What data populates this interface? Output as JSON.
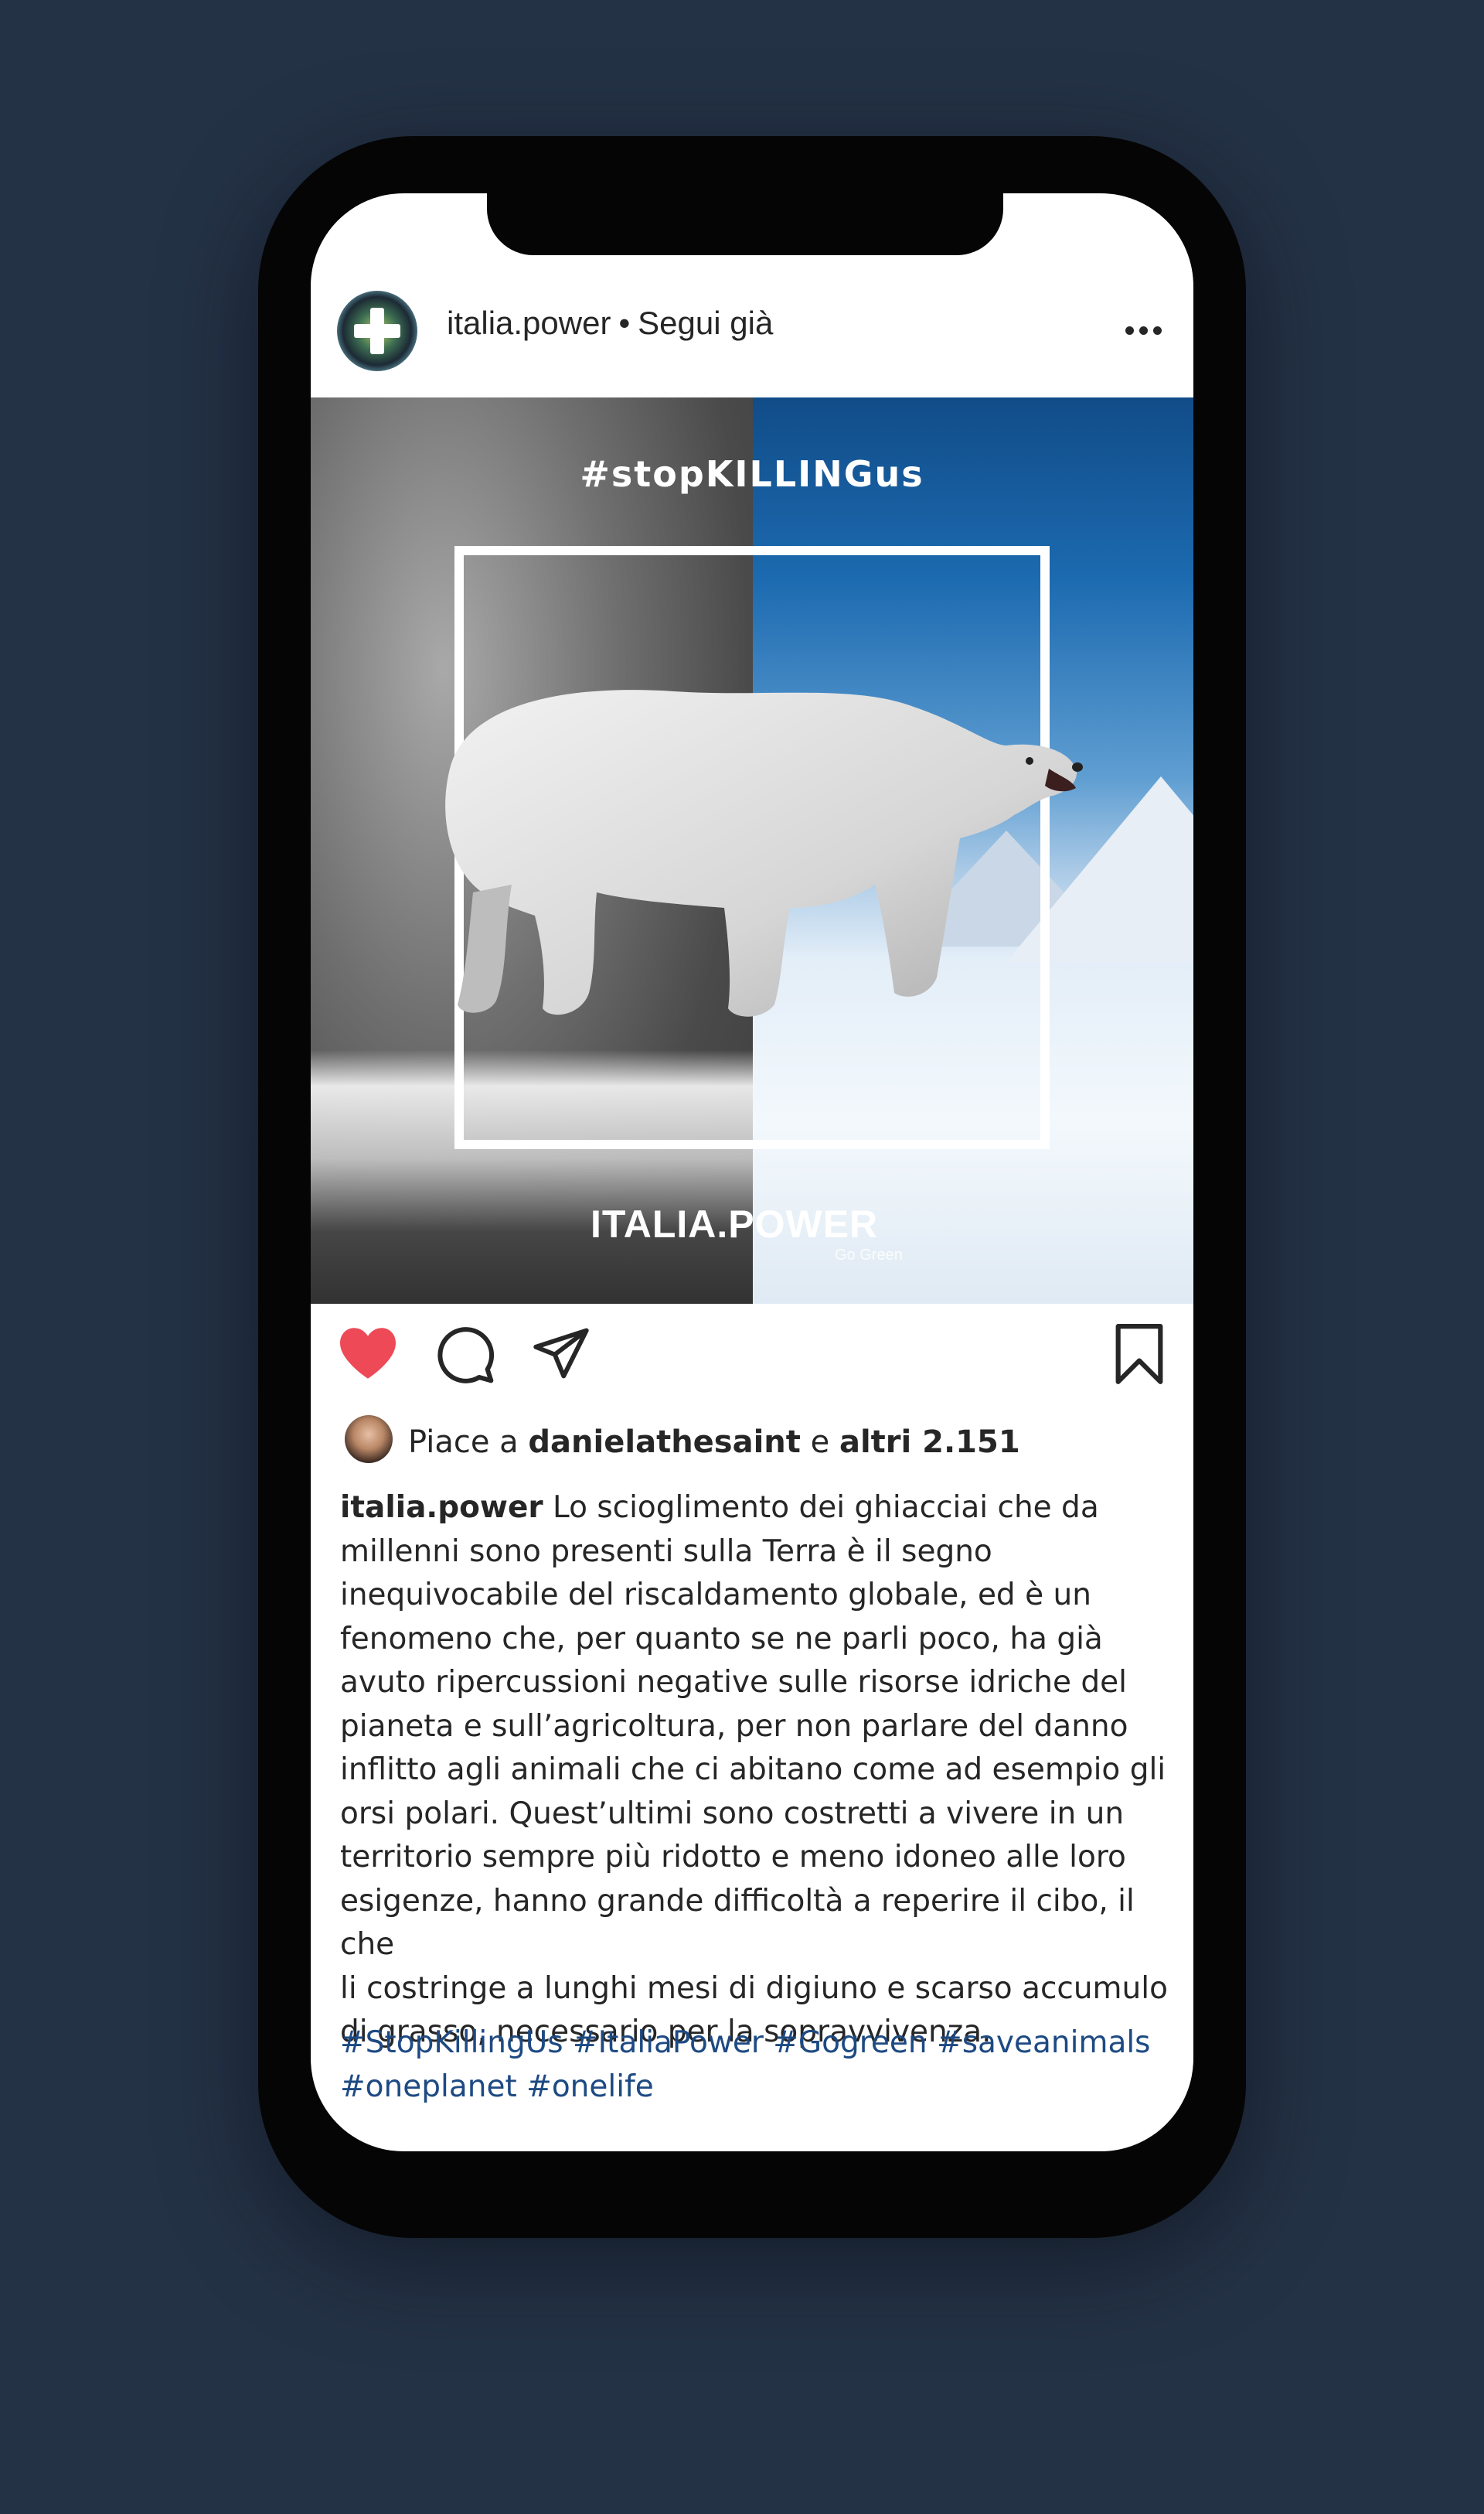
{
  "post": {
    "username": "italia.power",
    "separator": "•",
    "follow_status": "Segui già",
    "more_icon": "more-horizontal-icon"
  },
  "image": {
    "hashtag_overlay": "#stopKILLINGus",
    "brand_text": "ITALIA.POWER",
    "brand_tagline": "Go Green",
    "colors": {
      "sky": "#1c6ab0",
      "snow": "#e3eef8",
      "grayscale": "#6f6f6f"
    }
  },
  "actions": {
    "like_icon": "heart-filled-icon",
    "comment_icon": "comment-icon",
    "share_icon": "paper-plane-icon",
    "save_icon": "bookmark-icon",
    "like_color": "#ed4956"
  },
  "likes": {
    "prefix": "Piace a",
    "user": "danielathesaint",
    "connector": "e",
    "others": "altri 2.151"
  },
  "caption": {
    "username": "italia.power",
    "lines": [
      "Lo scioglimento dei ghiacciai che da",
      "millenni sono presenti sulla Terra è il segno",
      "inequivocabile del riscaldamento globale, ed è un",
      "fenomeno che, per quanto se ne parli poco, ha già",
      "avuto ripercussioni negative sulle risorse idriche del",
      "pianeta e sull’agricoltura, per non parlare del danno",
      "inflitto agli animali che ci abitano come ad esempio gli",
      "orsi polari. Quest’ultimi sono costretti a vivere in un",
      "territorio sempre più ridotto e meno idoneo alle loro",
      "esigenze, hanno grande difficoltà a reperire il cibo, il che",
      "li costringe a lunghi mesi di digiuno e scarso accumulo",
      "di grasso, necessario per la sopravvivenza."
    ],
    "hashtags_line1": "#StopKillingUs #ItaliaPower #Gogreen #saveanimals",
    "hashtags_line2": "#oneplanet #onelife"
  }
}
